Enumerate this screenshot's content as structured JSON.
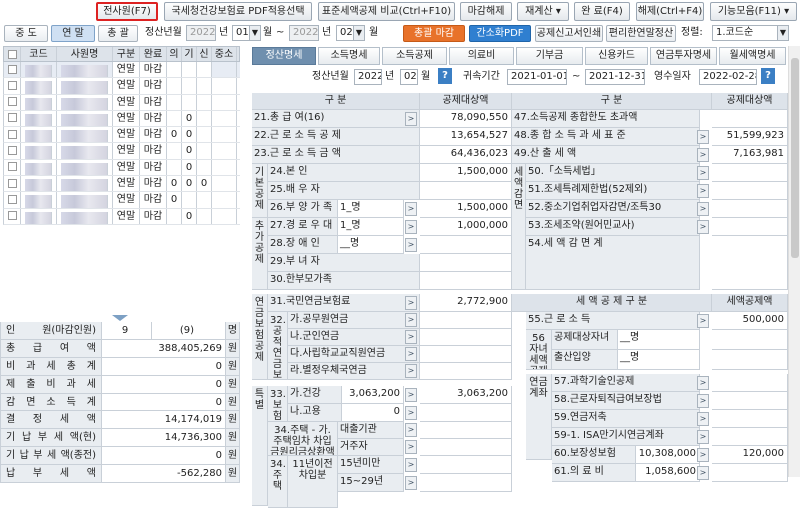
{
  "toolbar": {
    "all_staff": "전사원(F7)",
    "nts_pdf": "국세청건강보험료 PDF적용선택",
    "std_compare": "표준세액공제 비교(Ctrl+F10)",
    "close": "마감해제",
    "recalc": "재계산",
    "complete": "완 료(F4)",
    "cancel": "해제(Ctrl+F4)",
    "functions": "기능모음(F11)"
  },
  "filter": {
    "mid": "중 도",
    "year_end": "연 말",
    "total": "총 괄",
    "period_label": "정산년월",
    "from_year": "2022",
    "from_month": "01",
    "to_year": "2022",
    "to_month": "02",
    "year_unit": "년",
    "month_unit": "월",
    "tilde": "~",
    "badge_total": "총괄 마감",
    "badge_pdf": "간소화PDF",
    "print_report": "공제신고서인쇄",
    "pay_check": "편리한연말정산",
    "sort_label": "정렬:",
    "sort_value": "1.코드순"
  },
  "left_grid": {
    "headers": [
      "코드",
      "사원명",
      "구분",
      "완료",
      "의",
      "기",
      "신",
      "중소"
    ],
    "rows": [
      [
        "연말",
        "마감",
        "",
        "",
        ""
      ],
      [
        "연말",
        "마감",
        "",
        "",
        ""
      ],
      [
        "연말",
        "마감",
        "",
        "",
        ""
      ],
      [
        "연말",
        "마감",
        "",
        "0",
        ""
      ],
      [
        "연말",
        "마감",
        "0",
        "0",
        ""
      ],
      [
        "연말",
        "마감",
        "",
        "0",
        ""
      ],
      [
        "연말",
        "마감",
        "",
        "0",
        ""
      ],
      [
        "연말",
        "마감",
        "0",
        "0",
        "0"
      ],
      [
        "연말",
        "마감",
        "0",
        "",
        ""
      ],
      [
        "연말",
        "마감",
        "",
        "0",
        ""
      ]
    ]
  },
  "summary": [
    {
      "k": "인 원(마감인원)",
      "v": "9",
      "v2": "(9)",
      "u": "명"
    },
    {
      "k": "총 급 여 액",
      "v": "388,405,269",
      "u": "원"
    },
    {
      "k": "비 과 세 총 계",
      "v": "0",
      "u": "원"
    },
    {
      "k": "제 출 비 과 세",
      "v": "0",
      "u": "원"
    },
    {
      "k": "감 면 소 득 계",
      "v": "0",
      "u": "원"
    },
    {
      "k": "결 정 세 액",
      "v": "14,174,019",
      "u": "원"
    },
    {
      "k": "기 납 부 세 액(현)",
      "v": "14,736,300",
      "u": "원"
    },
    {
      "k": "기 납 부 세 액(종전)",
      "v": "0",
      "u": "원"
    },
    {
      "k": "납 부 세 액",
      "v": "-562,280",
      "u": "원"
    }
  ],
  "tabs": [
    "정산명세",
    "소득명세",
    "소득공제",
    "의료비",
    "기부금",
    "신용카드",
    "연금투자명세",
    "월세액명세"
  ],
  "detail": {
    "period_label": "정산년월",
    "year": "2022",
    "year_unit": "년",
    "month": "02",
    "month_unit": "월",
    "attr_label": "귀속기간",
    "attr_from": "2021-01-01",
    "tilde": "~",
    "attr_to": "2021-12-31",
    "receipt_label": "영수일자",
    "receipt_date": "2022-02-28"
  },
  "grid": {
    "h_left": "구 분",
    "h_amt": "공제대상액",
    "h_right": "구 분",
    "h_amt2": "공제대상액",
    "r21": "21.총 급 여(16)",
    "v21": "78,090,550",
    "r22": "22.근 로 소 득 공 제",
    "v22": "13,654,527",
    "r23": "23.근 로 소 득 금 액",
    "v23": "64,436,023",
    "r47": "47.소득공제 종합한도 초과액",
    "r48": "48.종 합 소 득 과 세 표 준",
    "v48": "51,599,923",
    "r49": "49.산 출 세 액",
    "v49": "7,163,981",
    "basic": "기본공제",
    "r24": "24.본 인",
    "v24": "1,500,000",
    "r25": "25.배 우 자",
    "r26": "26.부 양 가 족",
    "c26": "1_명",
    "v26": "1,500,000",
    "extra": "추가공제",
    "r27": "27.경 로 우 대",
    "c27": "1_명",
    "v27": "1,000,000",
    "r28": "28.장 애 인",
    "c28": "__명",
    "r29": "29.부 녀 자",
    "r30": "30.한부모가족",
    "reduce": "세액감면",
    "r50": "50.「소득세법」",
    "r51": "51.조세특례제한법(52제외)",
    "r52": "52.중소기업취업자감면/조특30",
    "r53": "53.조세조약(원어민교사)",
    "r54": "54.세 액 감 면 계",
    "pension": "연금보험공제",
    "r31": "31.국민연금보험료",
    "v31": "2,772,900",
    "r32": "32.공적연금보험공제",
    "r32a": "가.공무원연금",
    "r32b": "나.군인연금",
    "r32c": "다.사립학교교직원연금",
    "r32d": "라.별정우체국연금",
    "h_credit": "세 액 공 제 구 분",
    "h_credit_amt": "세액공제액",
    "r55": "55.근 로 소 득",
    "v55": "500,000",
    "r56": "56자녀세액공제",
    "r56a": "공제대상자녀",
    "c56a": "__명",
    "r56b": "출산입양",
    "c56b": "__명",
    "r33": "33.보험",
    "r33a": "가.건강",
    "c33a": "3,063,200",
    "v33": "3,063,200",
    "r33b": "나.고용",
    "c33b": "0",
    "r34": "34.주택 - 가.주택임차 차입금원리금상환액",
    "r34a": "대출기관",
    "r34b": "거주자",
    "special": "특별",
    "r34c": "34.주택",
    "r34d": "11년이전차입분",
    "r34e": "15년미만",
    "r34f": "15~29년",
    "pen2": "연금계좌",
    "r57": "57.과학기술인공제",
    "r58": "58.근로자퇴직급여보장법",
    "r59": "59.연금저축",
    "r591": "59-1. ISA만기시연금계좌",
    "r60": "60.보장성보험",
    "c60": "10,308,000",
    "v60": "120,000",
    "r61": "61.의 료 비",
    "c61": "1,058,600"
  }
}
